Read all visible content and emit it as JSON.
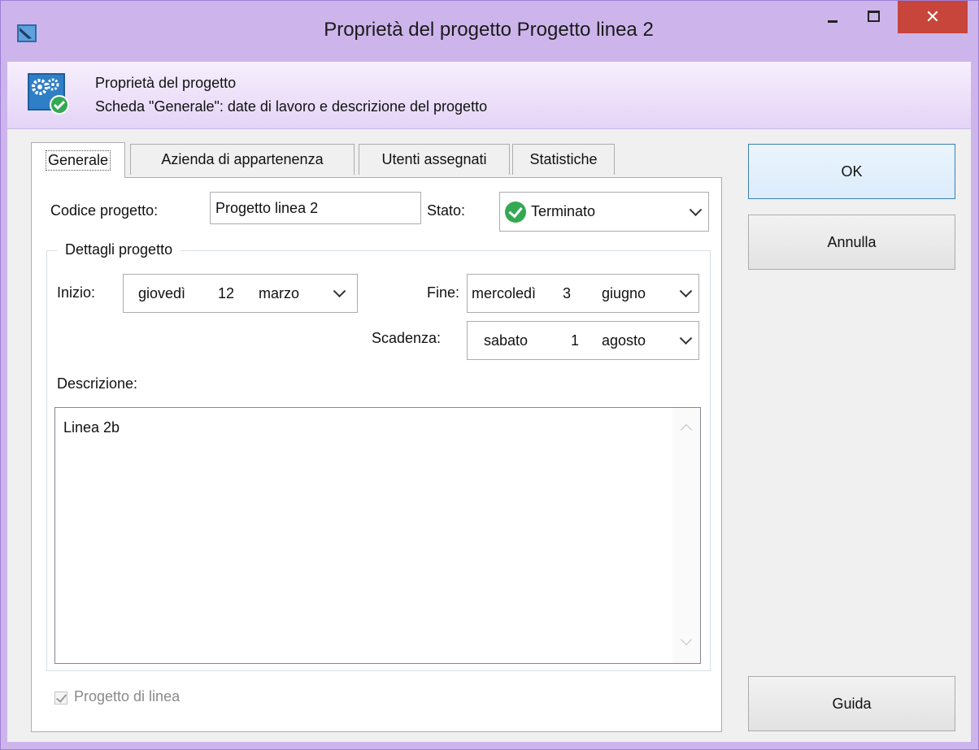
{
  "window": {
    "title": "Proprietà del progetto Progetto linea 2",
    "minimize": "–",
    "maximize": "☐",
    "close": "✕"
  },
  "header": {
    "title": "Proprietà del progetto",
    "subtitle": "Scheda \"Generale\": date di lavoro e descrizione del progetto",
    "icon": "settings-check-icon"
  },
  "tabs": [
    {
      "label": "Generale",
      "active": true
    },
    {
      "label": "Azienda di appartenenza",
      "active": false
    },
    {
      "label": "Utenti assegnati",
      "active": false
    },
    {
      "label": "Statistiche",
      "active": false
    }
  ],
  "form": {
    "code_label": "Codice progetto:",
    "code_value": "Progetto linea 2",
    "state_label": "Stato:",
    "state_value": "Terminato",
    "state_icon": "check-circle-icon",
    "group_title": "Dettagli progetto",
    "start_label": "Inizio:",
    "start_weekday": "giovedì",
    "start_day": "12",
    "start_month": "marzo",
    "end_label": "Fine:",
    "end_weekday": "mercoledì",
    "end_day": "3",
    "end_month": "giugno",
    "deadline_label": "Scadenza:",
    "deadline_weekday": "sabato",
    "deadline_day": "1",
    "deadline_month": "agosto",
    "description_label": "Descrizione:",
    "description_value": "Linea 2b",
    "line_project_label": "Progetto di linea",
    "line_project_checked": true
  },
  "buttons": {
    "ok": "OK",
    "cancel": "Annulla",
    "help": "Guida"
  },
  "colors": {
    "title_bar": "#cdb5ec",
    "close_button": "#c7453a",
    "state_ok": "#34a853"
  }
}
